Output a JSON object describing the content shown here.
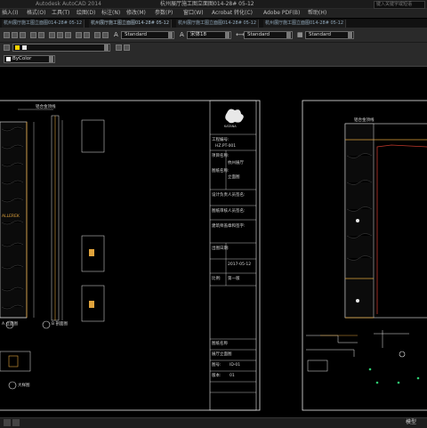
{
  "window": {
    "title_left": "Autodesk AutoCAD 2014",
    "title_middle": "杭州展厅施工图立面图014-28# 05-12",
    "title_right": "键入关键字或短语"
  },
  "menu": [
    "插入(I)",
    "格式(O)",
    "工具(T)",
    "绘图(D)",
    "标注(N)",
    "修改(M)",
    "参数(P)",
    "窗口(W)",
    "Acrobat 转化(C)",
    "Adobe PDF(B)",
    "帮助(H)"
  ],
  "tabs": [
    "杭州展厅施工图立面图014-28# 05-12",
    "杭州展厅施工图立面图014-28# 05-12",
    "杭州展厅施工图立面图014-28# 05-12",
    "杭州展厅施工图立面图014-28# 05-12"
  ],
  "toolbar": {
    "text_style": "Standard",
    "font": "宋体18",
    "dim_style": "Standard",
    "table_style": "Standard",
    "color_control": "ByColor"
  },
  "drawing": {
    "title_top": "铝合金顶线",
    "title_top_right": "铝合金顶线",
    "label_left_mid": "ALLEREK",
    "label_elev": "A 立面图",
    "label_section": "B 剖面图",
    "label_detail": "大样图",
    "tb_project_no": "工程编号:",
    "tb_project_val": "HZ.PT-001",
    "tb_project_name": "项目名称:",
    "tb_company": "杭州展厅",
    "tb_drawing": "图纸名称:",
    "tb_sheet": "立面图",
    "tb_designer": "设计负责人员签名:",
    "tb_drafter": "图纸审核人员签名:",
    "tb_date_label": "出图日期:",
    "tb_date": "2017-05-12",
    "tb_scale_label": "比例:",
    "tb_scale": "第一版",
    "tb_approval": "建筑师盖章和签字:",
    "tb_info": "图纸名称",
    "tb_info_val": "展厅立面图",
    "tb_no": "图号:",
    "tb_no_val": "ID-01",
    "tb_ver": "版本:",
    "tb_ver_val": "01",
    "logo_text": "KATANA"
  },
  "status": {
    "model": "模型"
  }
}
